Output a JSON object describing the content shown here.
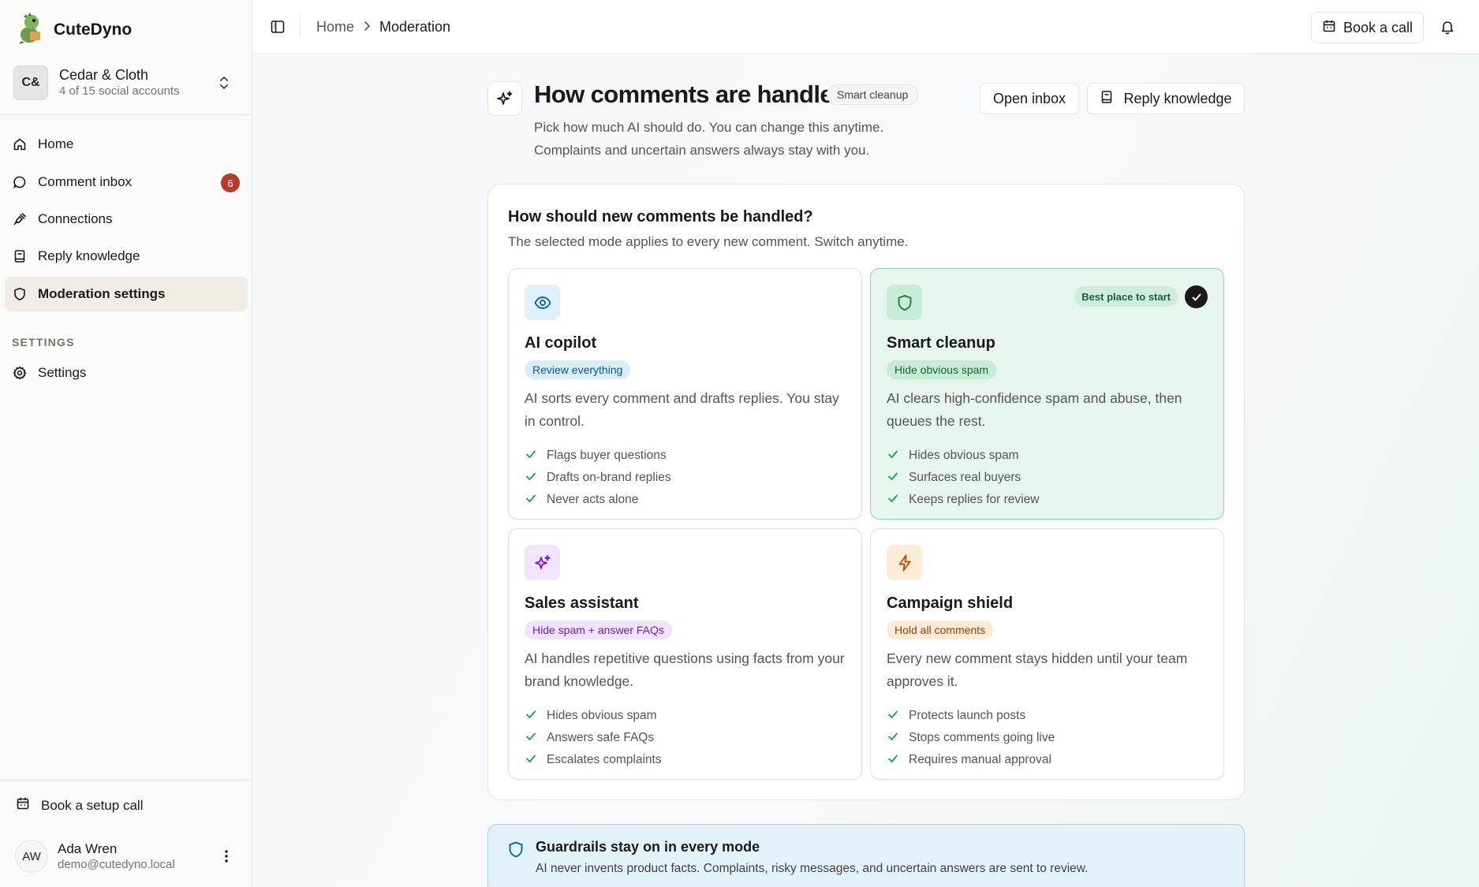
{
  "brand": {
    "name": "CuteDyno",
    "logo_icon": "dino-logo-icon"
  },
  "account": {
    "initials": "C&",
    "name": "Cedar & Cloth",
    "subtitle": "4 of 15 social accounts"
  },
  "nav": [
    {
      "label": "Home",
      "icon": "home-icon"
    },
    {
      "label": "Comment inbox",
      "icon": "message-icon",
      "badge": "6"
    },
    {
      "label": "Connections",
      "icon": "plug-icon"
    },
    {
      "label": "Reply knowledge",
      "icon": "book-icon"
    },
    {
      "label": "Moderation settings",
      "icon": "shield-icon",
      "active": true
    }
  ],
  "settings_section": {
    "label": "SETTINGS",
    "items": [
      {
        "label": "Settings",
        "icon": "gear-icon"
      }
    ]
  },
  "footer": {
    "setup_call": "Book a setup call",
    "user": {
      "initials": "AW",
      "name": "Ada Wren",
      "email": "demo@cutedyno.local"
    }
  },
  "topbar": {
    "breadcrumb": [
      "Home",
      "Moderation"
    ],
    "book_call": "Book a call"
  },
  "header": {
    "title": "How comments are handled",
    "badge": "Smart cleanup",
    "desc_line1": "Pick how much AI should do. You can change this anytime.",
    "desc_line2": "Complaints and uncertain answers always stay with you.",
    "open_inbox": "Open inbox",
    "reply_knowledge": "Reply knowledge"
  },
  "modes": {
    "title": "How should new comments be handled?",
    "subtitle": "The selected mode applies to every new comment. Switch anytime.",
    "cards": [
      {
        "title": "AI copilot",
        "pill": "Review everything",
        "icon": "eye-icon",
        "desc": "AI sorts every comment and drafts replies. You stay in control.",
        "features": [
          "Flags buyer questions",
          "Drafts on-brand replies",
          "Never acts alone"
        ],
        "colors": {
          "icon_bg": "#dff1fb",
          "icon_fg": "#0369a1",
          "pill_bg": "#d8eefa",
          "pill_fg": "#075985"
        }
      },
      {
        "title": "Smart cleanup",
        "pill": "Hide obvious spam",
        "icon": "shield-icon",
        "desc": "AI clears high-confidence spam and abuse, then queues the rest.",
        "features": [
          "Hides obvious spam",
          "Surfaces real buyers",
          "Keeps replies for review"
        ],
        "selected": true,
        "recommend": "Best place to start",
        "colors": {
          "icon_bg": "#c9ecd9",
          "icon_fg": "#15803d",
          "pill_bg": "#c6ebd7",
          "pill_fg": "#166534"
        }
      },
      {
        "title": "Sales assistant",
        "pill": "Hide spam + answer FAQs",
        "icon": "sparkles-icon",
        "desc": "AI handles repetitive questions using facts from your brand knowledge.",
        "features": [
          "Hides obvious spam",
          "Answers safe FAQs",
          "Escalates complaints"
        ],
        "colors": {
          "icon_bg": "#f0e5fd",
          "icon_fg": "#7e22ce",
          "pill_bg": "#efe3fd",
          "pill_fg": "#6b21a8"
        }
      },
      {
        "title": "Campaign shield",
        "pill": "Hold all comments",
        "icon": "bolt-icon",
        "desc": "Every new comment stays hidden until your team approves it.",
        "features": [
          "Protects launch posts",
          "Stops comments going live",
          "Requires manual approval"
        ],
        "colors": {
          "icon_bg": "#fdecd6",
          "icon_fg": "#b45309",
          "pill_bg": "#fcebd4",
          "pill_fg": "#92400e"
        }
      }
    ]
  },
  "guardrails": {
    "title": "Guardrails stay on in every mode",
    "text": "AI never invents product facts. Complaints, risky messages, and uncertain answers are sent to review."
  }
}
